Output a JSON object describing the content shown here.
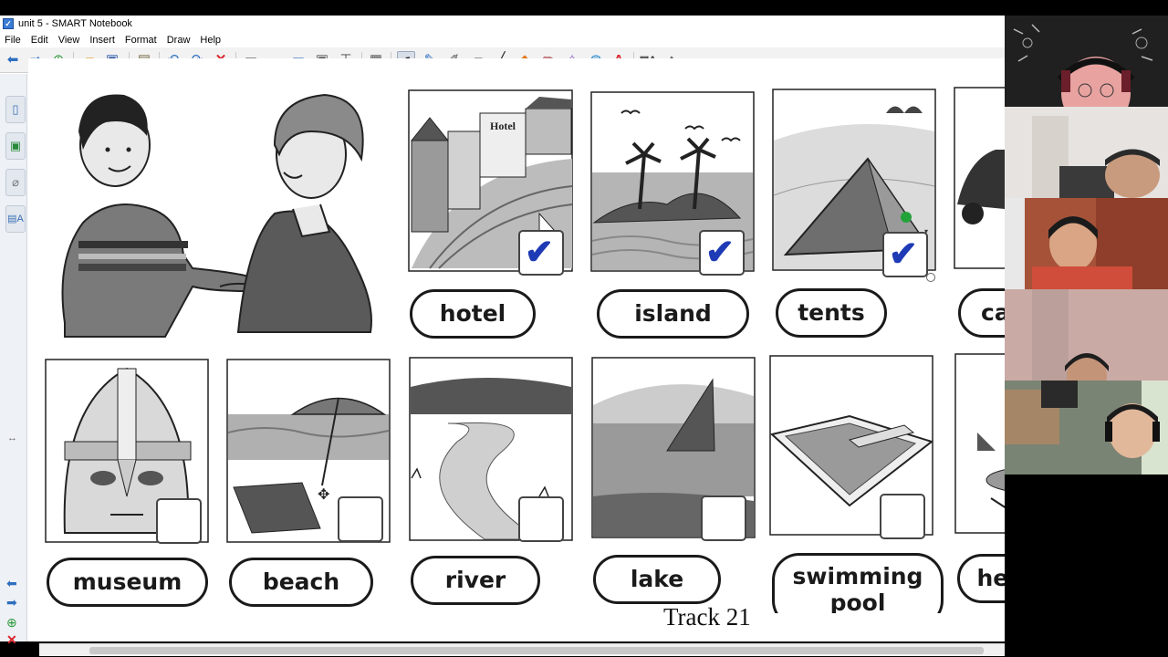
{
  "window": {
    "title": "unit 5 - SMART Notebook",
    "app_icon": "smart-notebook-icon"
  },
  "menu": [
    "File",
    "Edit",
    "View",
    "Insert",
    "Format",
    "Draw",
    "Help"
  ],
  "toolbar_icons": [
    "back-icon",
    "forward-icon",
    "add-page-icon",
    "open-icon",
    "save-icon",
    "paste-icon",
    "undo-icon",
    "redo-icon",
    "delete-icon",
    "screen-shade-icon",
    "display-icon",
    "projector-icon",
    "capture-icon",
    "document-camera-icon",
    "table-icon",
    "select-icon",
    "pen-icon",
    "creative-pen-icon",
    "eraser-icon",
    "line-icon",
    "shapes-icon",
    "fill-icon",
    "magic-pen-icon",
    "fill-bucket-icon",
    "text-icon",
    "properties-icon",
    "move-toolbar-icon"
  ],
  "page": {
    "track_label": "Track 21",
    "cards": [
      {
        "label": "hotel",
        "checked": true
      },
      {
        "label": "island",
        "checked": true
      },
      {
        "label": "tents",
        "checked": true
      },
      {
        "label": "ca",
        "checked": false
      },
      {
        "label": "museum",
        "checked": false
      },
      {
        "label": "beach",
        "checked": false
      },
      {
        "label": "river",
        "checked": false
      },
      {
        "label": "lake",
        "checked": false
      },
      {
        "label": "swimming pool",
        "checked": false
      },
      {
        "label": "helicopter",
        "checked": false
      }
    ],
    "hotel_sign": "Hotel"
  },
  "colors": {
    "check": "#1e3ab5",
    "accent": "#2d6fc0",
    "sidebar_red": "#d9262c",
    "green_handle": "#22a33a"
  }
}
